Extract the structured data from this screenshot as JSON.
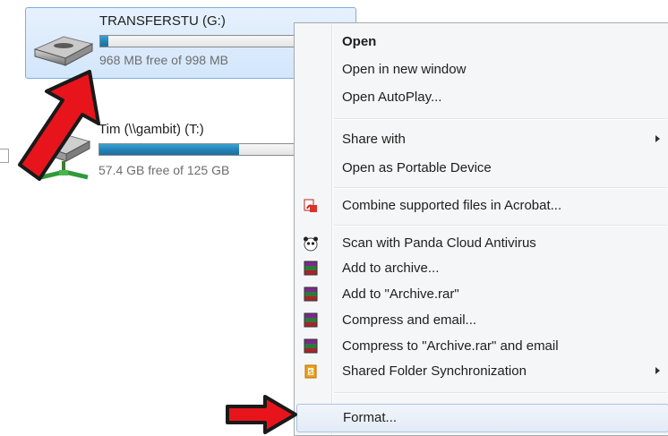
{
  "drives": [
    {
      "title": "TRANSFERSTU (G:)",
      "free_text": "968 MB free of 998 MB",
      "used_fraction": 0.03,
      "selected": true
    },
    {
      "title": "Tim (\\\\gambit) (T:)",
      "free_text": "57.4 GB free of 125 GB",
      "used_fraction": 0.54,
      "selected": false
    }
  ],
  "context_menu": {
    "items": {
      "open": "Open",
      "open_new_window": "Open in new window",
      "open_autoplay": "Open AutoPlay...",
      "share_with": "Share with",
      "open_portable": "Open as Portable Device",
      "combine_acrobat": "Combine supported files in Acrobat...",
      "scan_panda": "Scan with Panda Cloud Antivirus",
      "add_archive": "Add to archive...",
      "add_archive_rar": "Add to \"Archive.rar\"",
      "compress_email": "Compress and email...",
      "compress_rar_email": "Compress to \"Archive.rar\" and email",
      "shared_folder_sync": "Shared Folder Synchronization",
      "format": "Format..."
    }
  },
  "colors": {
    "highlight_arrow": "#e8141c",
    "selection_bg": "#d3e6fb",
    "capacity_fill": "#2280b5"
  }
}
